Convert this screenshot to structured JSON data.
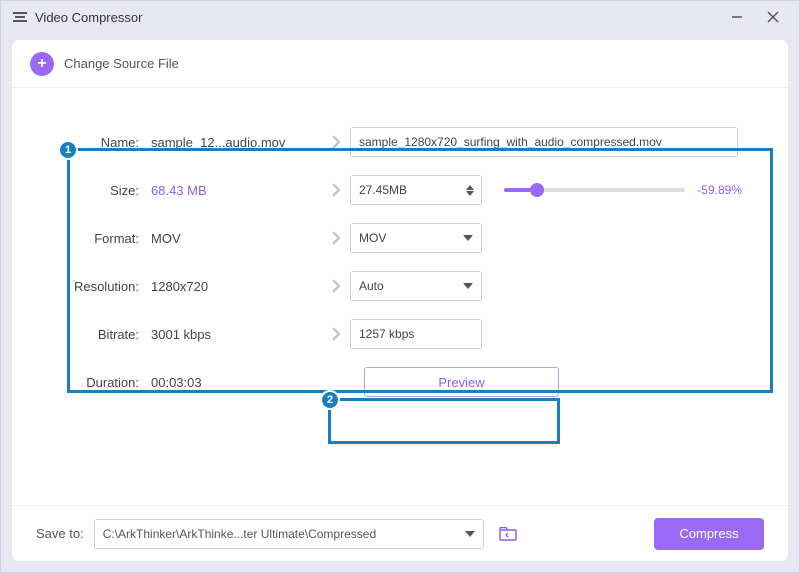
{
  "window": {
    "title": "Video Compressor"
  },
  "topbar": {
    "change_source": "Change Source File"
  },
  "badges": {
    "one": "1",
    "two": "2"
  },
  "labels": {
    "name": "Name:",
    "size": "Size:",
    "format": "Format:",
    "resolution": "Resolution:",
    "bitrate": "Bitrate:",
    "duration": "Duration:",
    "save_to": "Save to:"
  },
  "source": {
    "name_short": "sample_12...audio.mov",
    "size": "68.43 MB",
    "format": "MOV",
    "resolution": "1280x720",
    "bitrate": "3001 kbps",
    "duration": "00:03:03"
  },
  "output": {
    "name": "sample_1280x720_surfing_with_audio_compressed.mov",
    "size": "27.45MB",
    "size_reduction_pct": "-59.89%",
    "slider_position_pct": 18,
    "format": "MOV",
    "resolution": "Auto",
    "bitrate": "1257 kbps"
  },
  "buttons": {
    "preview": "Preview",
    "compress": "Compress"
  },
  "save_path": "C:\\ArkThinker\\ArkThinke...ter Ultimate\\Compressed"
}
